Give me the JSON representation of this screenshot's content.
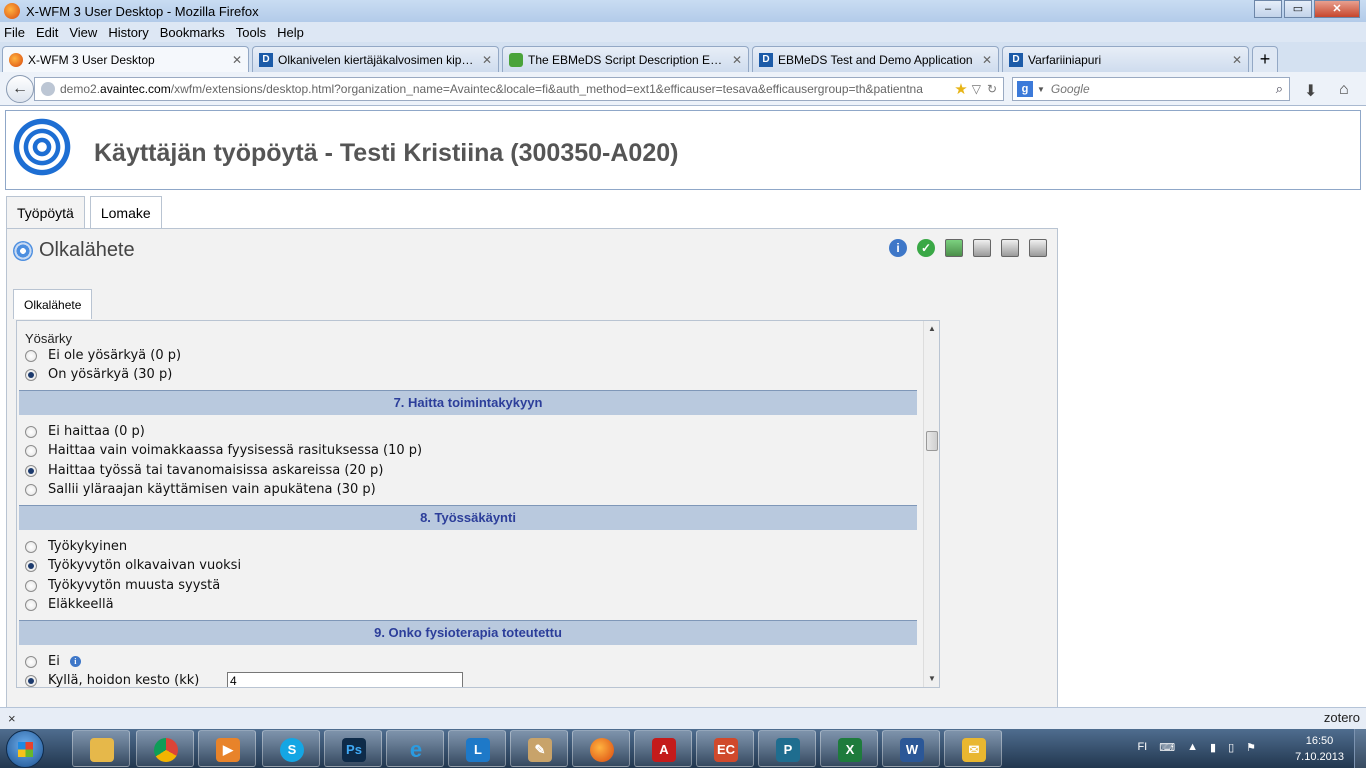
{
  "window": {
    "title": "X-WFM 3 User Desktop - Mozilla Firefox",
    "controls": [
      "–",
      "▭",
      "✕"
    ]
  },
  "menu": [
    "File",
    "Edit",
    "View",
    "History",
    "Bookmarks",
    "Tools",
    "Help"
  ],
  "browser_tabs": [
    {
      "label": "X-WFM 3 User Desktop",
      "icon": "firefox-icon"
    },
    {
      "label": "Olkanivelen kiertäjäkalvosimen kiputi...",
      "icon": "d-icon"
    },
    {
      "label": "The EBMeDS Script Description Editor",
      "icon": "puzzle-icon"
    },
    {
      "label": "EBMeDS Test and Demo Application",
      "icon": "d-icon"
    },
    {
      "label": "Varfariiniapuri",
      "icon": "d-icon"
    }
  ],
  "navbar": {
    "url_prefix": "demo2.",
    "url_host": "avaintec.com",
    "url_path": "/xwfm/extensions/desktop.html?organization_name=Avaintec&locale=fi&auth_method=ext1&efficauser=tesava&efficausergroup=th&patientna",
    "search_placeholder": "Google"
  },
  "app": {
    "title": "Käyttäjän työpöytä - Testi Kristiina (300350-A020)",
    "tabs": [
      "Työpöytä",
      "Lomake"
    ],
    "active_tab": "Lomake"
  },
  "form": {
    "title": "Olkalähete",
    "subtab": "Olkalähete",
    "night_pain": {
      "label": "Yösärky",
      "options": [
        {
          "label": "Ei ole yösärkyä (0 p)",
          "selected": false
        },
        {
          "label": "On yösärkyä (30 p)",
          "selected": true
        }
      ]
    },
    "sections": [
      {
        "heading": "7. Haitta toimintakykyyn",
        "options": [
          {
            "label": "Ei haittaa (0 p)",
            "selected": false
          },
          {
            "label": "Haittaa vain voimakkaassa fyysisessä rasituksessa (10 p)",
            "selected": false
          },
          {
            "label": "Haittaa työssä tai tavanomaisissa askareissa (20 p)",
            "selected": true
          },
          {
            "label": "Sallii yläraajan käyttämisen vain apukätena (30 p)",
            "selected": false
          }
        ]
      },
      {
        "heading": "8. Työssäkäynti",
        "options": [
          {
            "label": "Työkykyinen",
            "selected": false
          },
          {
            "label": "Työkyvytön olkavaivan vuoksi",
            "selected": true
          },
          {
            "label": "Työkyvytön muusta syystä",
            "selected": false
          },
          {
            "label": "Eläkkeellä",
            "selected": false
          }
        ]
      },
      {
        "heading": "9. Onko fysioterapia toteutettu",
        "options": [
          {
            "label": "Ei",
            "selected": false
          },
          {
            "label": "Kyllä, hoidon kesto (kk)",
            "selected": true
          }
        ],
        "duration_value": "4"
      }
    ]
  },
  "statusbar": {
    "close": "×",
    "zotero": "zotero"
  },
  "taskbar": {
    "items": [
      "explorer-icon",
      "chrome-icon",
      "media-player-icon",
      "skype-icon",
      "photoshop-icon",
      "internet-explorer-icon",
      "lync-icon",
      "paint-icon",
      "firefox-icon",
      "acrobat-icon",
      "easycapture-icon",
      "publisher-icon",
      "excel-icon",
      "word-icon",
      "outlook-icon"
    ],
    "language": "FI",
    "time": "16:50",
    "date": "7.10.2013"
  }
}
